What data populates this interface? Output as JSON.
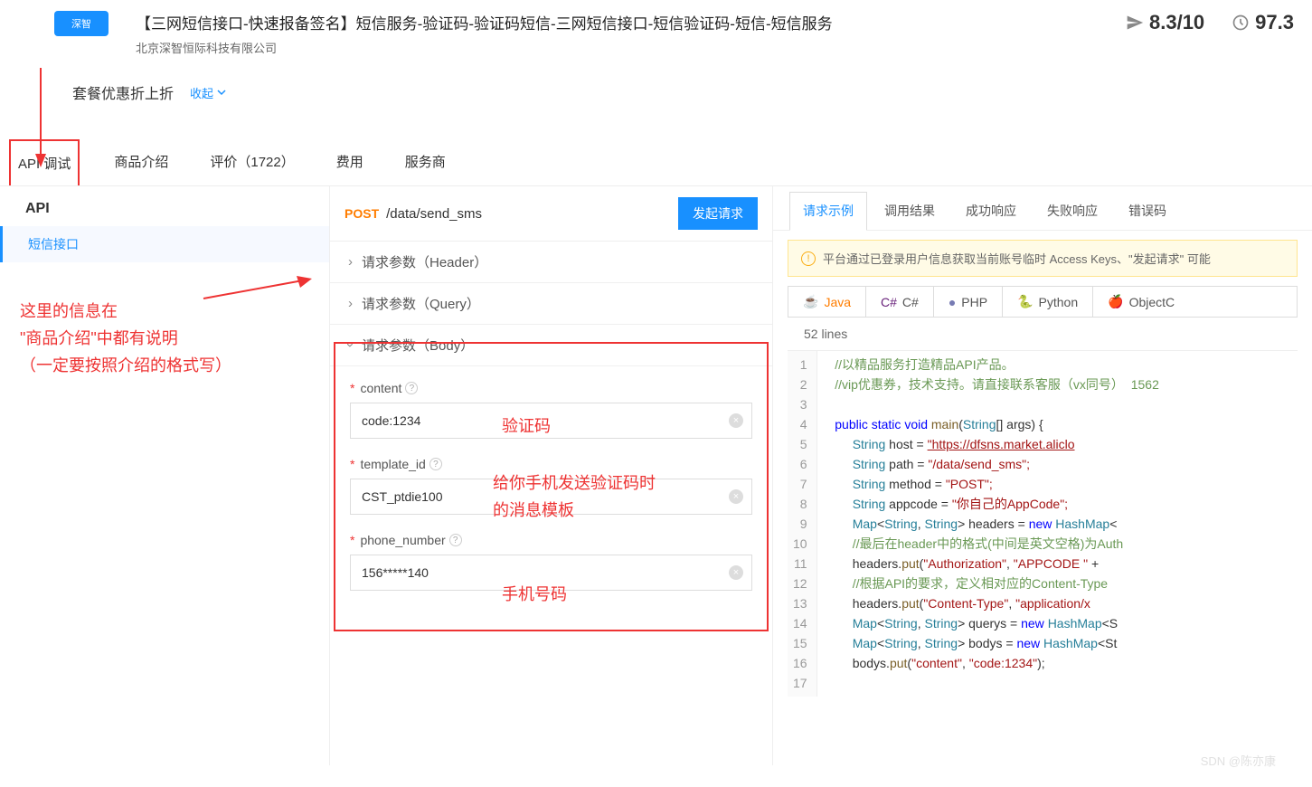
{
  "header": {
    "logo_text": "深智",
    "title": "【三网短信接口-快速报备签名】短信服务-验证码-验证码短信-三网短信接口-短信验证码-短信-短信服务",
    "company": "北京深智恒际科技有限公司",
    "rating1": "8.3/10",
    "rating2": "97.3"
  },
  "promo": {
    "title": "套餐优惠折上折",
    "collapse": "收起"
  },
  "tabs": {
    "t1": "API 调试",
    "t2": "商品介绍",
    "t3": "评价（1722）",
    "t4": "费用",
    "t5": "服务商"
  },
  "sidebar": {
    "heading": "API",
    "item1": "短信接口"
  },
  "endpoint": {
    "method": "POST",
    "path": "/data/send_sms",
    "invoke": "发起请求"
  },
  "sections": {
    "header": "请求参数（Header）",
    "query": "请求参数（Query）",
    "body": "请求参数（Body）"
  },
  "fields": {
    "content": {
      "label": "content",
      "value": "code:1234"
    },
    "template": {
      "label": "template_id",
      "value": "CST_ptdie100"
    },
    "phone": {
      "label": "phone_number",
      "value": "156*****140"
    }
  },
  "annos": {
    "code": "验证码",
    "tpl1": "给你手机发送验证码时",
    "tpl2": "的消息模板",
    "phone": "手机号码",
    "left1": "这里的信息在",
    "left2": "\"商品介绍\"中都有说明",
    "left3": "（一定要按照介绍的格式写）"
  },
  "resp_tabs": {
    "t1": "请求示例",
    "t2": "调用结果",
    "t3": "成功响应",
    "t4": "失败响应",
    "t5": "错误码"
  },
  "banner": "平台通过已登录用户信息获取当前账号临时 Access Keys、\"发起请求\" 可能",
  "langs": {
    "java": "Java",
    "csharp": "C#",
    "php": "PHP",
    "python": "Python",
    "objc": "ObjectC"
  },
  "lines_label": "52 lines",
  "code": {
    "l1": "//以精品服务打造精品API产品。",
    "l2_a": "//vip优惠券，技术支持。请直接联系客服（vx同号）  ",
    "l2_b": "1562",
    "l4": "public static void main(String[] args) {",
    "l5_a": "String host = ",
    "l5_b": "\"https://dfsns.market.aliclo",
    "l6_a": "String path = ",
    "l6_b": "\"/data/send_sms\";",
    "l7_a": "String method = ",
    "l7_b": "\"POST\";",
    "l8_a": "String appcode = ",
    "l8_b": "\"你自己的AppCode\";",
    "l9_a": "Map<String, String> headers = ",
    "l9_b": "new",
    "l9_c": " HashMap<",
    "l10": "//最后在header中的格式(中间是英文空格)为Auth",
    "l11_a": "headers.put(",
    "l11_b": "\"Authorization\"",
    "l11_c": ", ",
    "l11_d": "\"APPCODE \"",
    "l11_e": " + ",
    "l12": "//根据API的要求，定义相对应的Content-Type",
    "l13_a": "headers.put(",
    "l13_b": "\"Content-Type\"",
    "l13_c": ", ",
    "l13_d": "\"application/x",
    "l14_a": "Map<String, String> querys = ",
    "l14_b": "new",
    "l14_c": " HashMap<S",
    "l15_a": "Map<String, String> bodys = ",
    "l15_b": "new",
    "l15_c": " HashMap<St",
    "l16_a": "bodys.put(",
    "l16_b": "\"content\"",
    "l16_c": ", ",
    "l16_d": "\"code:1234\"",
    "l16_e": ");"
  },
  "watermark": "SDN @陈亦康"
}
